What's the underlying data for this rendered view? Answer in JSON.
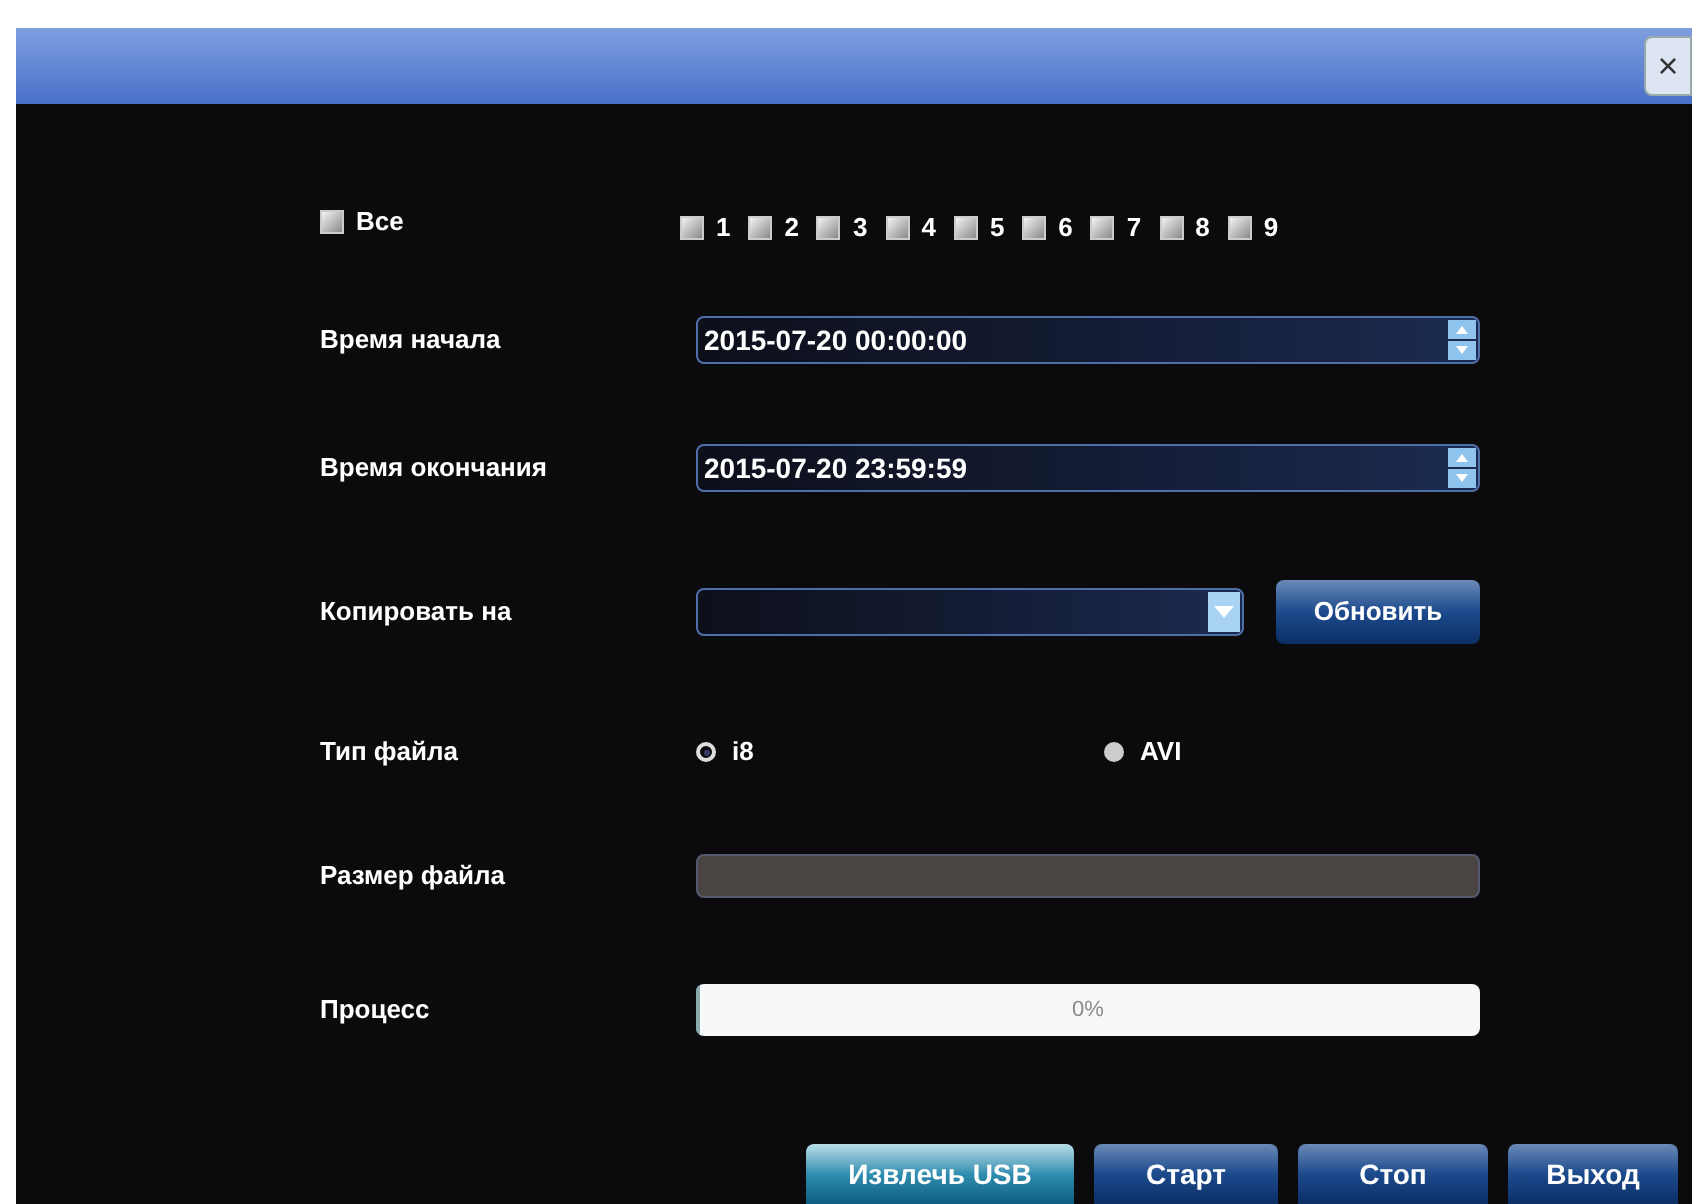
{
  "window": {
    "close": "×"
  },
  "channels_all": {
    "label": "Все",
    "checked": false
  },
  "channels": [
    {
      "label": "1",
      "checked": false
    },
    {
      "label": "2",
      "checked": false
    },
    {
      "label": "3",
      "checked": false
    },
    {
      "label": "4",
      "checked": false
    },
    {
      "label": "5",
      "checked": false
    },
    {
      "label": "6",
      "checked": false
    },
    {
      "label": "7",
      "checked": false
    },
    {
      "label": "8",
      "checked": false
    },
    {
      "label": "9",
      "checked": false
    }
  ],
  "start_time": {
    "label": "Время начала",
    "value": "2015-07-20 00:00:00"
  },
  "end_time": {
    "label": "Время окончания",
    "value": "2015-07-20 23:59:59"
  },
  "copy_to": {
    "label": "Копировать на",
    "refresh": "Обновить"
  },
  "file_type": {
    "label": "Тип файла",
    "options": [
      {
        "label": "i8",
        "selected": true
      },
      {
        "label": "AVI",
        "selected": false
      }
    ]
  },
  "file_size": {
    "label": "Размер файла"
  },
  "progress": {
    "label": "Процесс",
    "level": 0,
    "reading": "0%"
  },
  "buttons": [
    {
      "label": "Извлечь USB",
      "focused": true
    },
    {
      "label": "Старт",
      "focused": false
    },
    {
      "label": "Стоп",
      "focused": false
    },
    {
      "label": "Выход",
      "focused": false
    }
  ]
}
